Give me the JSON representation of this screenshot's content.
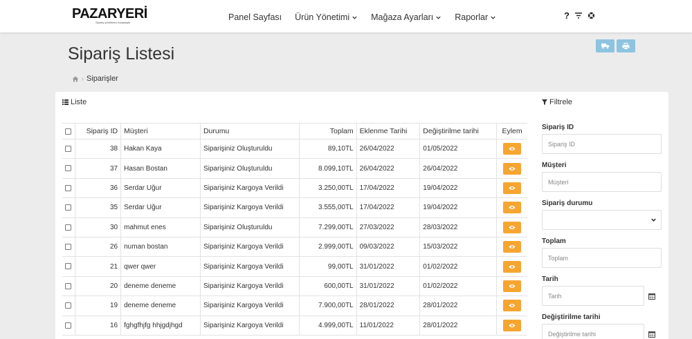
{
  "header": {
    "logo": "PAZARYERİ",
    "logo_tagline": "Sipariş yönetimini kolaylaştır"
  },
  "nav": [
    {
      "label": "Panel Sayfası",
      "has_dropdown": false
    },
    {
      "label": "Ürün Yönetimi",
      "has_dropdown": true
    },
    {
      "label": "Mağaza Ayarları",
      "has_dropdown": true
    },
    {
      "label": "Raporlar",
      "has_dropdown": true
    }
  ],
  "tools": {
    "help": "?",
    "filter_icon": "filter-icon",
    "support_icon": "lifebuoy-icon"
  },
  "page": {
    "title": "Sipariş Listesi",
    "breadcrumb_current": "Siparişler"
  },
  "list_panel": {
    "title": "Liste"
  },
  "filter_panel": {
    "title": "Filtrele",
    "fields": {
      "order_id": {
        "label": "Sipariş ID",
        "placeholder": "Sipariş ID"
      },
      "customer": {
        "label": "Müşteri",
        "placeholder": "Müşteri"
      },
      "status": {
        "label": "Sipariş durumu",
        "value": ""
      },
      "total": {
        "label": "Toplam",
        "placeholder": "Toplam"
      },
      "date": {
        "label": "Tarih",
        "placeholder": "Tarih"
      },
      "modified": {
        "label": "Değiştirilme tarihi",
        "placeholder": "Değiştirilme tarihi"
      }
    }
  },
  "table": {
    "headers": {
      "id": "Sipariş ID",
      "customer": "Müşteri",
      "status": "Durumu",
      "total": "Toplam",
      "added": "Eklenme Tarihi",
      "modified": "Değiştirilme tarihi",
      "action": "Eylem"
    },
    "rows": [
      {
        "id": "38",
        "customer": "Hakan Kaya",
        "status": "Siparişiniz Oluşturuldu",
        "total": "89,10TL",
        "added": "26/04/2022",
        "modified": "01/05/2022"
      },
      {
        "id": "37",
        "customer": "Hasan Bostan",
        "status": "Siparişiniz Oluşturuldu",
        "total": "8.099,10TL",
        "added": "26/04/2022",
        "modified": "26/04/2022"
      },
      {
        "id": "36",
        "customer": "Serdar Uğur",
        "status": "Siparişiniz Kargoya Verildi",
        "total": "3.250,00TL",
        "added": "17/04/2022",
        "modified": "19/04/2022"
      },
      {
        "id": "35",
        "customer": "Serdar Uğur",
        "status": "Siparişiniz Kargoya Verildi",
        "total": "3.555,00TL",
        "added": "17/04/2022",
        "modified": "19/04/2022"
      },
      {
        "id": "30",
        "customer": "mahmut enes",
        "status": "Siparişiniz Oluşturuldu",
        "total": "7.299,00TL",
        "added": "27/03/2022",
        "modified": "28/03/2022"
      },
      {
        "id": "26",
        "customer": "numan bostan",
        "status": "Siparişiniz Kargoya Verildi",
        "total": "2.999,00TL",
        "added": "09/03/2022",
        "modified": "15/03/2022"
      },
      {
        "id": "21",
        "customer": "qwer qwer",
        "status": "Siparişiniz Kargoya Verildi",
        "total": "99,00TL",
        "added": "31/01/2022",
        "modified": "01/02/2022"
      },
      {
        "id": "20",
        "customer": "deneme deneme",
        "status": "Siparişiniz Kargoya Verildi",
        "total": "600,00TL",
        "added": "31/01/2022",
        "modified": "01/02/2022"
      },
      {
        "id": "19",
        "customer": "deneme deneme",
        "status": "Siparişiniz Kargoya Verildi",
        "total": "7.900,00TL",
        "added": "28/01/2022",
        "modified": "28/01/2022"
      },
      {
        "id": "16",
        "customer": "fghgfhjfg hhjgdjhgd",
        "status": "Siparişiniz Kargoya Verildi",
        "total": "4.999,00TL",
        "added": "11/01/2022",
        "modified": "28/01/2022"
      }
    ]
  },
  "colors": {
    "action_button": "#f7a531",
    "top_buttons": "#8ec4df"
  }
}
